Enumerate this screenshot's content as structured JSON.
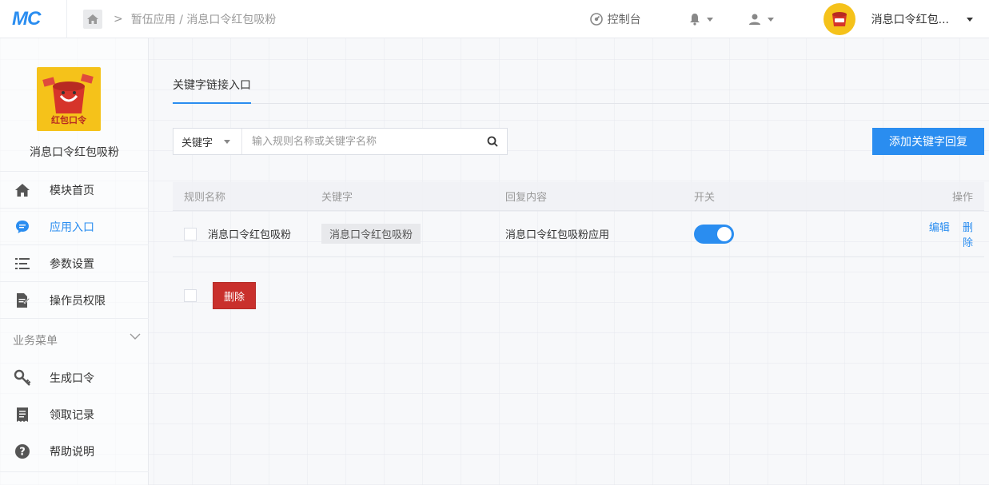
{
  "brand": {
    "logo_text": "MC"
  },
  "breadcrumb": {
    "parent": "暂伍应用",
    "separator": "/",
    "current": "消息口令红包吸粉"
  },
  "topbar": {
    "console_label": "控制台",
    "user_name": "消息口令红包..."
  },
  "app": {
    "name": "消息口令红包吸粉",
    "logo_text": "红包口令"
  },
  "sidebar": {
    "items": [
      {
        "label": "模块首页",
        "icon": "home-icon"
      },
      {
        "label": "应用入口",
        "icon": "chat-bubble-icon",
        "active": true
      },
      {
        "label": "参数设置",
        "icon": "list-settings-icon"
      },
      {
        "label": "操作员权限",
        "icon": "document-edit-icon"
      }
    ],
    "section_title": "业务菜单",
    "biz_items": [
      {
        "label": "生成口令",
        "icon": "key-icon"
      },
      {
        "label": "领取记录",
        "icon": "receipt-icon"
      },
      {
        "label": "帮助说明",
        "icon": "question-icon"
      }
    ]
  },
  "main": {
    "tab_label": "关键字链接入口",
    "search": {
      "select_label": "关键字",
      "placeholder": "输入规则名称或关键字名称"
    },
    "add_button": "添加关键字回复",
    "table": {
      "headers": [
        "规则名称",
        "关键字",
        "回复内容",
        "开关",
        "操作"
      ],
      "rows": [
        {
          "name": "消息口令红包吸粉",
          "keyword": "消息口令红包吸粉",
          "reply": "消息口令红包吸粉应用",
          "enabled": true,
          "edit": "编辑",
          "delete": "删除"
        }
      ]
    },
    "bulk_delete": "删除"
  },
  "colors": {
    "accent": "#2a8df0",
    "danger": "#c9302c",
    "app_yellow": "#f5c21a",
    "envelope_red": "#d6342a"
  }
}
